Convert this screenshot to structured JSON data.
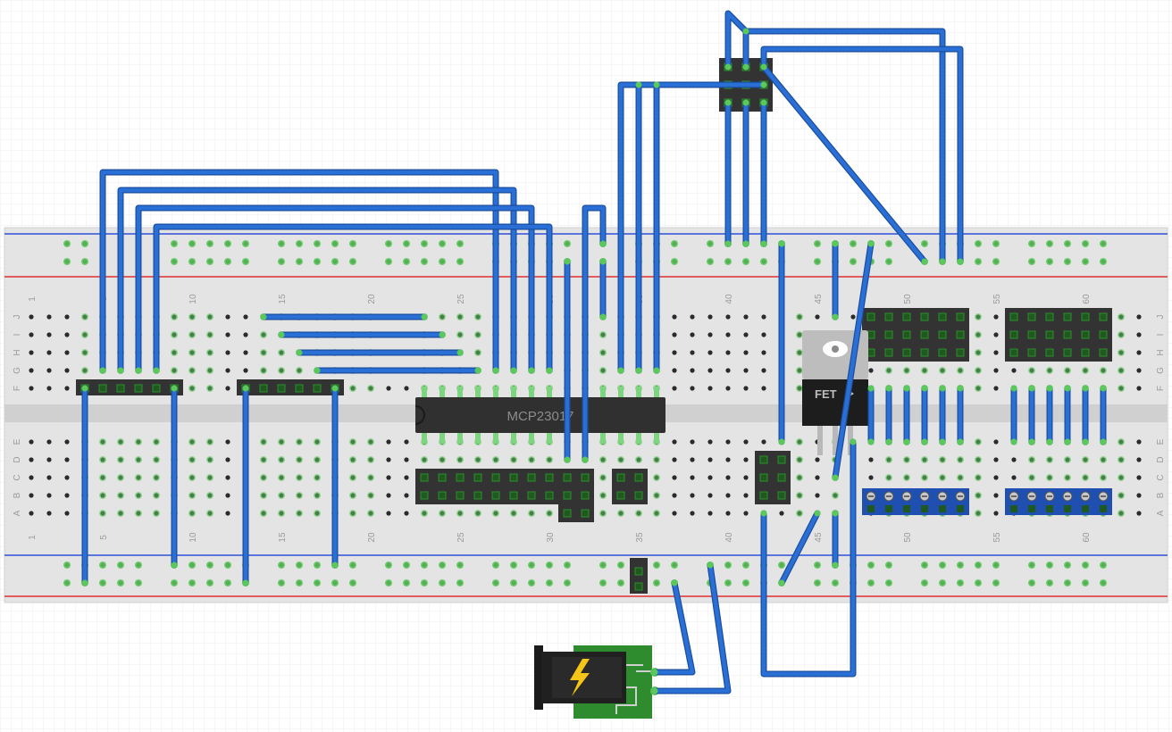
{
  "chip": {
    "label": "MCP23017"
  },
  "fet": {
    "label": "FET"
  },
  "column_numbers": [
    "1",
    "5",
    "10",
    "15",
    "20",
    "25",
    "30",
    "35",
    "40",
    "45",
    "50",
    "55",
    "60"
  ],
  "row_letters_top": [
    "J",
    "I",
    "H",
    "G",
    "F"
  ],
  "row_letters_bottom": [
    "E",
    "D",
    "C",
    "B",
    "A"
  ],
  "colors": {
    "wire": "#2a6fd6",
    "wire_dark": "#1b4f9e",
    "hole_active": "#5ac85a",
    "rail_blue": "#2f4fd8",
    "rail_red": "#e03030",
    "board": "#e4e4e4",
    "board_gap": "#d0d0d0",
    "header": "#3a3a3a",
    "pcb_green": "#2e8b2e",
    "bolt": "#f5c518"
  },
  "icons": {
    "power_jack": "lightning-bolt-icon",
    "fet_tab": "mounting-hole-icon"
  }
}
